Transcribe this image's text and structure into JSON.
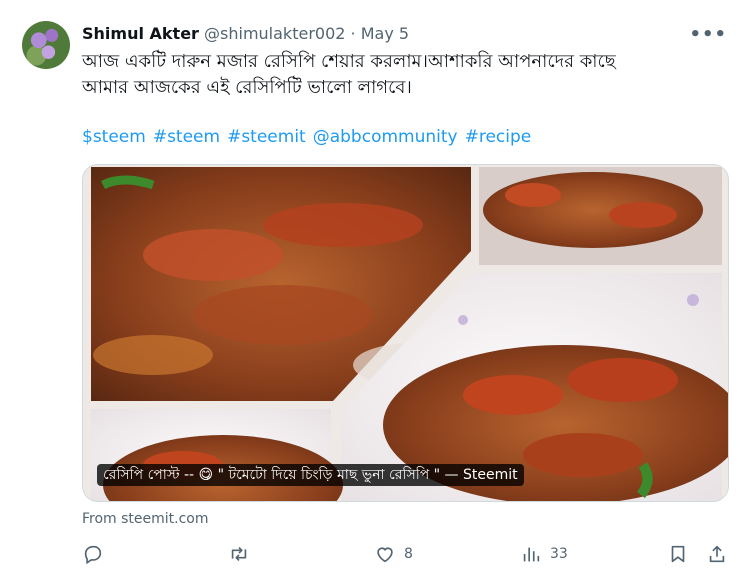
{
  "tweet": {
    "author_name": "Shimul Akter",
    "handle": "@shimulakter002",
    "separator": "·",
    "date": "May 5",
    "text_lines": [
      "আজ একটি দারুন মজার রেসিপি শেয়ার করলাম।আশাকরি আপনাদের কাছে",
      "আমার আজকের এই রেসিপিটি ভালো লাগবে।"
    ],
    "hashtags": [
      "$steem",
      "#steem",
      "#steemit",
      "@abbcommunity",
      "#recipe"
    ]
  },
  "card": {
    "caption": "রেসিপি পোস্ট -- 😋 \" টমেটো দিয়ে চিংড়ি মাছ ভুনা রেসিপি \" — Steemit",
    "source": "From steemit.com"
  },
  "actions": {
    "reply_count": "",
    "retweet_count": "",
    "like_count": "8",
    "views_count": "33"
  },
  "icons": [
    "more-icon",
    "reply-icon",
    "retweet-icon",
    "like-icon",
    "views-icon",
    "bookmark-icon",
    "share-icon"
  ],
  "colors": {
    "link": "#1d9bf0",
    "muted": "#536471",
    "text": "#0f1419"
  }
}
